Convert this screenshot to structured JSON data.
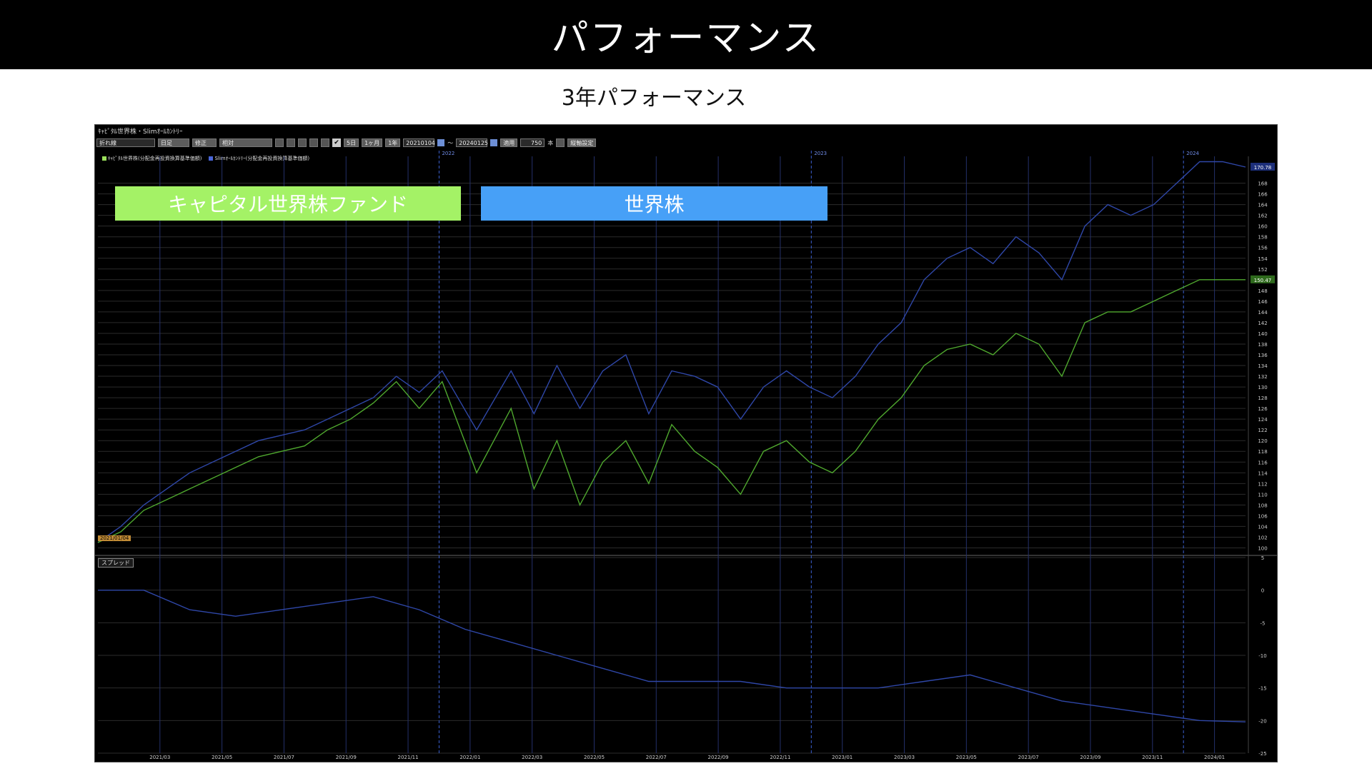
{
  "header": {
    "title": "パフォーマンス"
  },
  "subtitle": "3年パフォーマンス",
  "labels": {
    "fund": "キャピタル世界株ファンド",
    "world": "世界株",
    "fund_color": "#a4f266",
    "world_color": "#47a0f7"
  },
  "window": {
    "title": "ｷｬﾋﾟﾀﾙ世界株・Slimｵｰﾙｶﾝﾄﾘｰ"
  },
  "toolbar": {
    "chart_type": "折れ線",
    "period": "日足",
    "adjust": "修正",
    "mode": "相対",
    "btn_5d": "5日",
    "btn_1m": "1ヶ月",
    "btn_1y": "1年",
    "start": "20210104",
    "tilde": "〜",
    "end": "20240125",
    "apply": "適用",
    "bars": "750",
    "bars_unit": "本",
    "axis_settings": "縦軸設定"
  },
  "legend": {
    "fund": "ｷｬﾋﾟﾀﾙ世界株(分配金再投資換算基準価額)",
    "world": "Slimｵｰﾙｶﾝﾄﾘｰ(分配金再投資換算基準価額)"
  },
  "date_tag": "2021/01/04",
  "spread_label": "スプレッド",
  "chart_data": {
    "type": "line",
    "x_ticks": [
      "2021/03",
      "2021/05",
      "2021/07",
      "2021/09",
      "2021/11",
      "2022/01",
      "2022/03",
      "2022/05",
      "2022/07",
      "2022/09",
      "2022/11",
      "2023/01",
      "2023/03",
      "2023/05",
      "2023/07",
      "2023/09",
      "2023/11",
      "2024/01"
    ],
    "year_marks": [
      "2022",
      "2023",
      "2024"
    ],
    "main": {
      "ylim": [
        99,
        173
      ],
      "y_ticks": [
        100,
        102,
        104,
        106,
        108,
        110,
        112,
        114,
        116,
        118,
        120,
        122,
        124,
        126,
        128,
        130,
        132,
        134,
        136,
        138,
        140,
        142,
        144,
        146,
        148,
        150,
        152,
        154,
        156,
        158,
        160,
        162,
        164,
        166,
        168
      ],
      "last_labels": {
        "world": "170.78",
        "fund": "150.47"
      },
      "x": [
        0,
        0.02,
        0.04,
        0.06,
        0.08,
        0.1,
        0.12,
        0.14,
        0.16,
        0.18,
        0.2,
        0.22,
        0.24,
        0.26,
        0.28,
        0.3,
        0.33,
        0.36,
        0.38,
        0.4,
        0.42,
        0.44,
        0.46,
        0.48,
        0.5,
        0.52,
        0.54,
        0.56,
        0.58,
        0.6,
        0.62,
        0.64,
        0.66,
        0.68,
        0.7,
        0.72,
        0.74,
        0.76,
        0.78,
        0.8,
        0.82,
        0.84,
        0.86,
        0.88,
        0.9,
        0.92,
        0.94,
        0.96,
        0.98,
        1.0
      ],
      "series": [
        {
          "name": "Slimｵｰﾙｶﾝﾄﾘｰ(分配金再投資換算基準価額)",
          "color": "#2f47a8",
          "values": [
            101,
            104,
            108,
            111,
            114,
            116,
            118,
            120,
            121,
            122,
            124,
            126,
            128,
            132,
            129,
            133,
            122,
            133,
            125,
            134,
            126,
            133,
            136,
            125,
            133,
            132,
            130,
            124,
            130,
            133,
            130,
            128,
            132,
            138,
            142,
            150,
            154,
            156,
            153,
            158,
            155,
            150,
            160,
            164,
            162,
            164,
            168,
            172,
            172,
            171
          ]
        },
        {
          "name": "ｷｬﾋﾟﾀﾙ世界株(分配金再投資換算基準価額)",
          "color": "#4fa82e",
          "values": [
            101,
            103,
            107,
            109,
            111,
            113,
            115,
            117,
            118,
            119,
            122,
            124,
            127,
            131,
            126,
            131,
            114,
            126,
            111,
            120,
            108,
            116,
            120,
            112,
            123,
            118,
            115,
            110,
            118,
            120,
            116,
            114,
            118,
            124,
            128,
            134,
            137,
            138,
            136,
            140,
            138,
            132,
            142,
            144,
            144,
            146,
            148,
            150,
            150,
            150
          ]
        }
      ]
    },
    "spread": {
      "name": "スプレッド",
      "ylim": [
        -25,
        5
      ],
      "y_ticks": [
        5,
        0,
        -5,
        -10,
        -15,
        -20,
        -25
      ],
      "x": [
        0,
        0.04,
        0.08,
        0.12,
        0.16,
        0.2,
        0.24,
        0.28,
        0.32,
        0.36,
        0.4,
        0.44,
        0.48,
        0.52,
        0.56,
        0.6,
        0.64,
        0.68,
        0.72,
        0.76,
        0.8,
        0.84,
        0.88,
        0.92,
        0.96,
        1.0
      ],
      "values": [
        0,
        0,
        -3,
        -4,
        -3,
        -2,
        -1,
        -3,
        -6,
        -8,
        -10,
        -12,
        -14,
        -14,
        -14,
        -15,
        -15,
        -15,
        -14,
        -13,
        -15,
        -17,
        -18,
        -19,
        -20,
        -20.2
      ],
      "color": "#2f47a8"
    }
  }
}
